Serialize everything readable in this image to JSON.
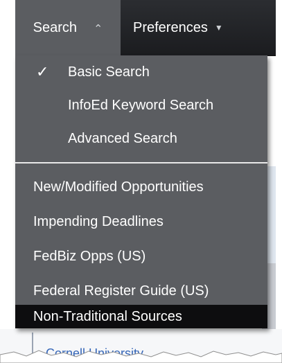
{
  "nav": {
    "search_label": "Search",
    "search_caret": "⌄",
    "prefs_label": "Preferences",
    "prefs_caret": "▼"
  },
  "menu": {
    "check_mark": "✓",
    "items": [
      {
        "label": "Basic Search",
        "checked": true
      },
      {
        "label": "InfoEd Keyword Search"
      },
      {
        "label": "Advanced Search"
      },
      {
        "label": "New/Modified Opportunities"
      },
      {
        "label": "Impending Deadlines"
      },
      {
        "label": "FedBiz Opps (US)"
      },
      {
        "label": "Federal Register Guide (US)"
      },
      {
        "label": "Non-Traditional Sources",
        "highlighted": true
      }
    ]
  },
  "background": {
    "bottom_link": "Cornell University"
  },
  "colors": {
    "menu_bg": "#5b5d61",
    "navbar_bg": "#1b1c1f",
    "highlight_bg": "#0d0d0f",
    "link": "#2a62c9"
  }
}
